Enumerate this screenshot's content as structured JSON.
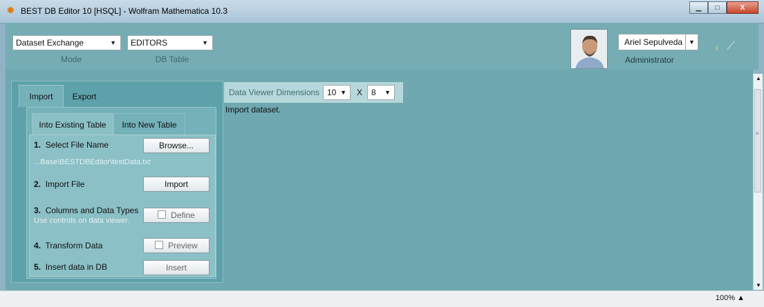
{
  "window": {
    "title": "BEST DB Editor 10 [HSQL] - Wolfram Mathematica 10.3",
    "buttons": {
      "minimize": "▁",
      "maximize": "□",
      "close": "X"
    }
  },
  "toolbar": {
    "mode_value": "Dataset Exchange",
    "mode_label": "Mode",
    "table_value": "EDITORS",
    "table_label": "DB Table",
    "user_name": "Ariel Sepulveda",
    "user_role": "Administrator",
    "icons": [
      "bulb-icon",
      "plug-icon"
    ]
  },
  "tabs": {
    "top": [
      "Import",
      "Export"
    ],
    "sub": [
      "Into Existing Table",
      "Into New Table"
    ]
  },
  "steps": {
    "s1_num": "1.",
    "s1_label": "Select File Name",
    "s1_button": "Browse...",
    "file_path": "...Base\\BESTDBEditor\\testData.txt",
    "s2_num": "2.",
    "s2_label": "Import File",
    "s2_button": "Import",
    "s3_num": "3.",
    "s3_label": "Columns and Data Types",
    "s3_note": "Use controls on data viewer.",
    "s3_button": "Define",
    "s4_num": "4.",
    "s4_label": "Transform Data",
    "s4_button": "Preview",
    "s5_num": "5.",
    "s5_label": "Insert data in DB",
    "s5_button": "Insert"
  },
  "viewer": {
    "label": "Data Viewer Dimensions",
    "rows": "10",
    "times": "X",
    "cols": "8",
    "message": "Import dataset."
  },
  "status": {
    "zoom": "100%"
  },
  "colors": {
    "accent": "#6fa8b0",
    "panel": "#5da2aa",
    "toolbar": "#76acb4"
  }
}
